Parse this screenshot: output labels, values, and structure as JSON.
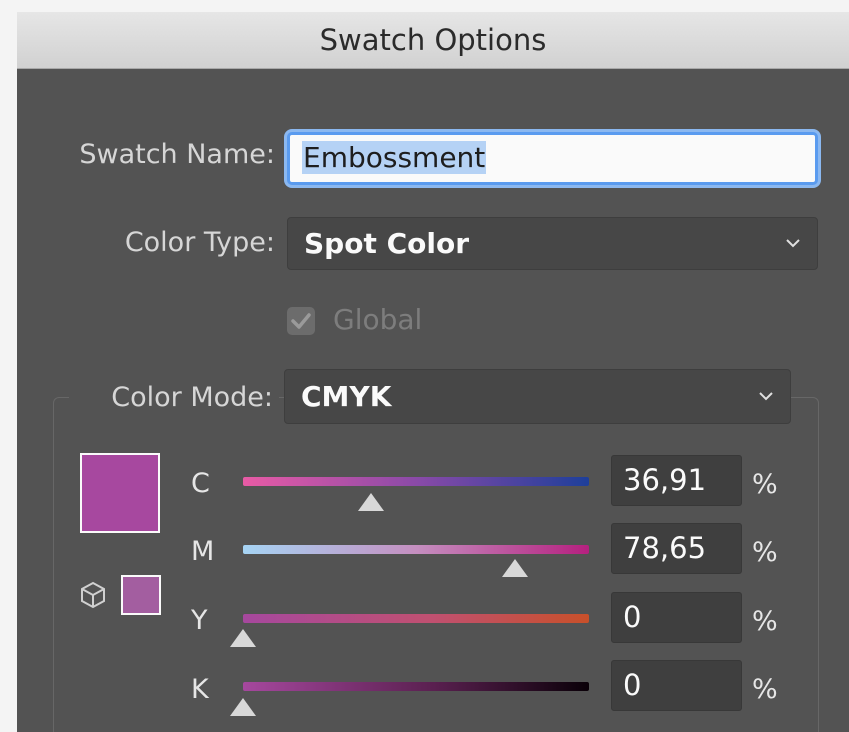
{
  "dialog": {
    "title": "Swatch Options"
  },
  "swatch_name": {
    "label": "Swatch Name:",
    "value": "Embossment"
  },
  "color_type": {
    "label": "Color Type:",
    "value": "Spot Color"
  },
  "global": {
    "label": "Global",
    "checked": true,
    "enabled": false
  },
  "color_mode": {
    "label": "Color Mode:",
    "value": "CMYK"
  },
  "preview": {
    "swatch_color": "#a7489f",
    "gamut_swatch_color": "#a35ea0"
  },
  "channels": [
    {
      "label": "C",
      "value": "36,91",
      "unit": "%",
      "level": 36.91
    },
    {
      "label": "M",
      "value": "78,65",
      "unit": "%",
      "level": 78.65
    },
    {
      "label": "Y",
      "value": "0",
      "unit": "%",
      "level": 0
    },
    {
      "label": "K",
      "value": "0",
      "unit": "%",
      "level": 0
    }
  ]
}
